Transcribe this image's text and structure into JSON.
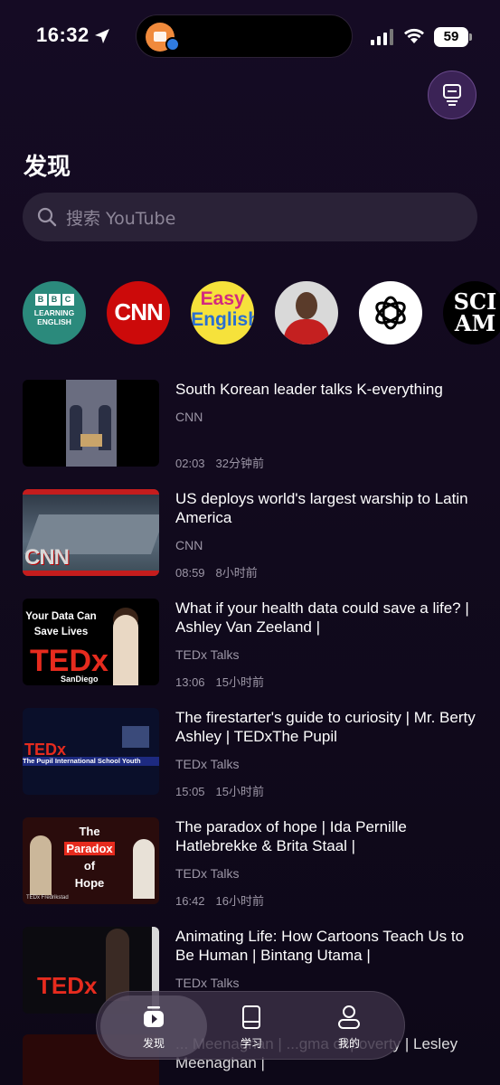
{
  "status_bar": {
    "time": "16:32",
    "battery": "59"
  },
  "page": {
    "title": "发现"
  },
  "search": {
    "placeholder": "搜索 YouTube"
  },
  "channels": [
    {
      "name": "BBC Learning English",
      "logo_text": [
        "B",
        "B",
        "C"
      ],
      "sub": "LEARNING ENGLISH"
    },
    {
      "name": "CNN",
      "logo_text": "CNN"
    },
    {
      "name": "Easy English",
      "logo_text": [
        "Easy",
        "English"
      ]
    },
    {
      "name": "Creator avatar"
    },
    {
      "name": "OpenAI"
    },
    {
      "name": "Scientific American",
      "logo_text": [
        "SCI",
        "AM"
      ]
    }
  ],
  "videos": [
    {
      "title": "South Korean leader talks K-everything",
      "channel": "CNN",
      "duration": "02:03",
      "age": "32分钟前"
    },
    {
      "title": "US deploys world's largest warship to Latin America",
      "channel": "CNN",
      "duration": "08:59",
      "age": "8小时前",
      "thumb_text": "CNN"
    },
    {
      "title": "What if your health data could save a life? | Ashley Van Zeeland |",
      "channel": "TEDx Talks",
      "duration": "13:06",
      "age": "15小时前",
      "thumb_text": "Your Data Can Save Lives",
      "thumb_logo": "TEDx",
      "thumb_sub": "SanDiego"
    },
    {
      "title": "The firestarter's guide to curiosity | Mr. Berty Ashley | TEDxThe Pupil",
      "channel": "TEDx Talks",
      "duration": "15:05",
      "age": "15小时前",
      "thumb_logo": "TEDx",
      "thumb_caption": "The Pupil International School Youth"
    },
    {
      "title": "The paradox of hope | Ida Pernille Hatlebrekke & Brita Staal |",
      "channel": "TEDx Talks",
      "duration": "16:42",
      "age": "16小时前",
      "thumb_lines": [
        "The",
        "Paradox",
        "of",
        "Hope"
      ],
      "thumb_tag": "TEDx Fredrikstad"
    },
    {
      "title": "Animating Life: How Cartoons Teach Us to Be Human | Bintang Utama |",
      "channel": "TEDx Talks",
      "duration": "",
      "age": "",
      "thumb_logo": "TEDx"
    }
  ],
  "partial_video": {
    "title": "... Meenaghan | ...gma of poverty | Lesley Meenaghan |"
  },
  "tabbar": {
    "tabs": [
      {
        "label": "发现",
        "icon": "play-icon",
        "active": true
      },
      {
        "label": "学习",
        "icon": "book-icon",
        "active": false
      },
      {
        "label": "我的",
        "icon": "person-icon",
        "active": false
      }
    ]
  },
  "colors": {
    "background": "#150b24",
    "accent": "#3b2356",
    "search_bg": "#2a2237",
    "tedx_red": "#e62b1e",
    "cnn_red": "#cc0a0a"
  }
}
